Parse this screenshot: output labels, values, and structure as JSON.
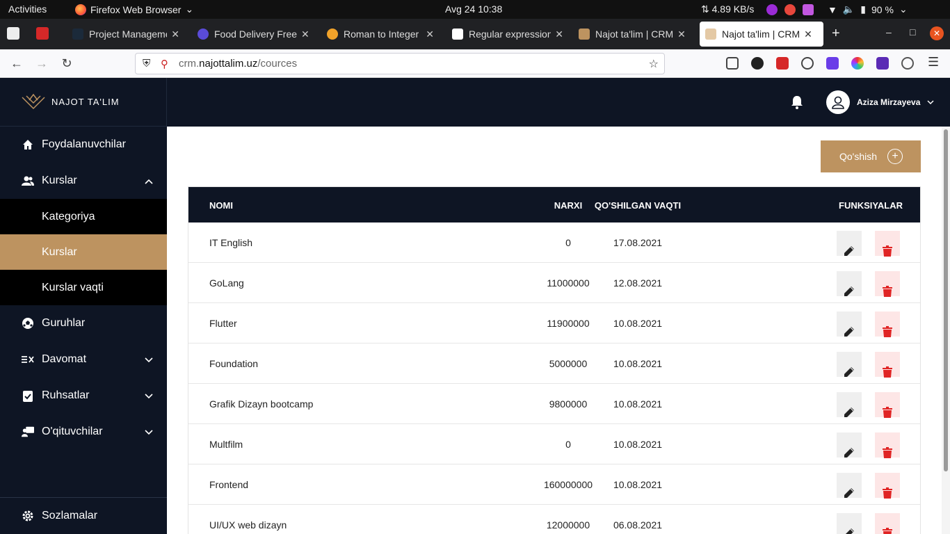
{
  "system_bar": {
    "activities": "Activities",
    "app": "Firefox Web Browser",
    "clock": "Avg 24  10:38",
    "net": "⇅ 4.89 KB/s",
    "battery": "90 %"
  },
  "browser": {
    "tabs": [
      {
        "title": "Project Manageme",
        "favicon": "sk-icon"
      },
      {
        "title": "Food Delivery Free",
        "favicon": "crown-icon"
      },
      {
        "title": "Roman to Integer -",
        "favicon": "leetcode-icon"
      },
      {
        "title": "Regular expression",
        "favicon": "regex-icon"
      },
      {
        "title": "Najot ta'lim | CRM",
        "favicon": "najot-icon"
      },
      {
        "title": "Najot ta'lim | CRM",
        "favicon": "najot-icon",
        "active": true
      }
    ],
    "url_prefix": "crm.",
    "url_domain": "najottalim.uz",
    "url_path": "/cources"
  },
  "app": {
    "brand": "NAJOT TA'LIM",
    "user_name": "Aziza Mirzayeva",
    "menu": {
      "users": "Foydalanuvchilar",
      "courses": "Kurslar",
      "sub_category": "Kategoriya",
      "sub_courses": "Kurslar",
      "sub_course_times": "Kurslar vaqti",
      "groups": "Guruhlar",
      "attendance": "Davomat",
      "permissions": "Ruhsatlar",
      "teachers": "O'qituvchilar",
      "settings": "Sozlamalar"
    },
    "add_button": "Qo'shish",
    "table": {
      "headers": {
        "name": "NOMI",
        "price": "NARXI",
        "date": "QO'SHILGAN VAQTI",
        "functions": "FUNKSIYALAR"
      },
      "rows": [
        {
          "name": "IT English",
          "price": "0",
          "date": "17.08.2021"
        },
        {
          "name": "GoLang",
          "price": "11000000",
          "date": "12.08.2021"
        },
        {
          "name": "Flutter",
          "price": "11900000",
          "date": "10.08.2021"
        },
        {
          "name": "Foundation",
          "price": "5000000",
          "date": "10.08.2021"
        },
        {
          "name": "Grafik Dizayn bootcamp",
          "price": "9800000",
          "date": "10.08.2021"
        },
        {
          "name": "Multfilm",
          "price": "0",
          "date": "10.08.2021"
        },
        {
          "name": "Frontend",
          "price": "160000000",
          "date": "10.08.2021"
        },
        {
          "name": "UI/UX web dizayn",
          "price": "12000000",
          "date": "06.08.2021"
        }
      ]
    }
  },
  "colors": {
    "dark": "#0e1524",
    "accent": "#bd9360",
    "danger": "#e02424"
  }
}
